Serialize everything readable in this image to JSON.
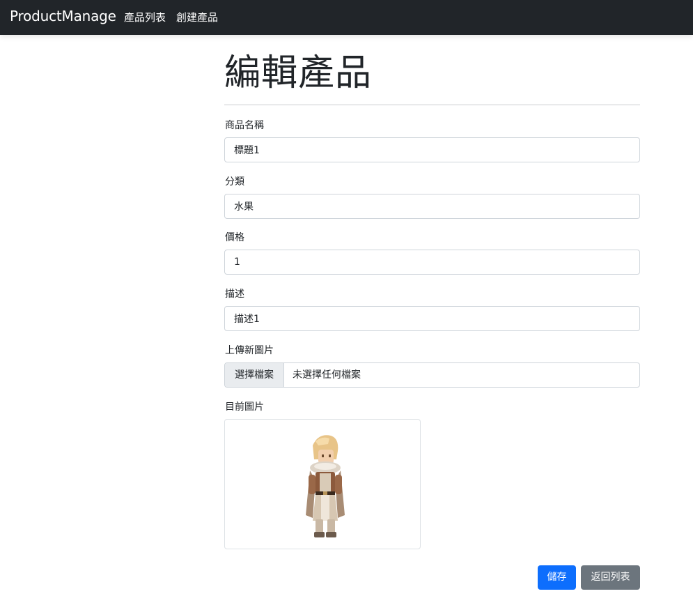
{
  "navbar": {
    "brand": "ProductManage",
    "links": [
      "產品列表",
      "創建產品"
    ]
  },
  "page": {
    "title": "編輯產品"
  },
  "form": {
    "name": {
      "label": "商品名稱",
      "value": "標題1"
    },
    "category": {
      "label": "分類",
      "value": "水果"
    },
    "price": {
      "label": "價格",
      "value": "1"
    },
    "description": {
      "label": "描述",
      "value": "描述1"
    },
    "upload": {
      "label": "上傳新圖片",
      "button": "選擇檔案",
      "status": "未選擇任何檔案"
    },
    "current_image": {
      "label": "目前圖片"
    }
  },
  "actions": {
    "save": "儲存",
    "back": "返回列表"
  },
  "colors": {
    "navbar_bg": "#212529",
    "primary": "#0d6efd",
    "secondary": "#6c757d"
  }
}
